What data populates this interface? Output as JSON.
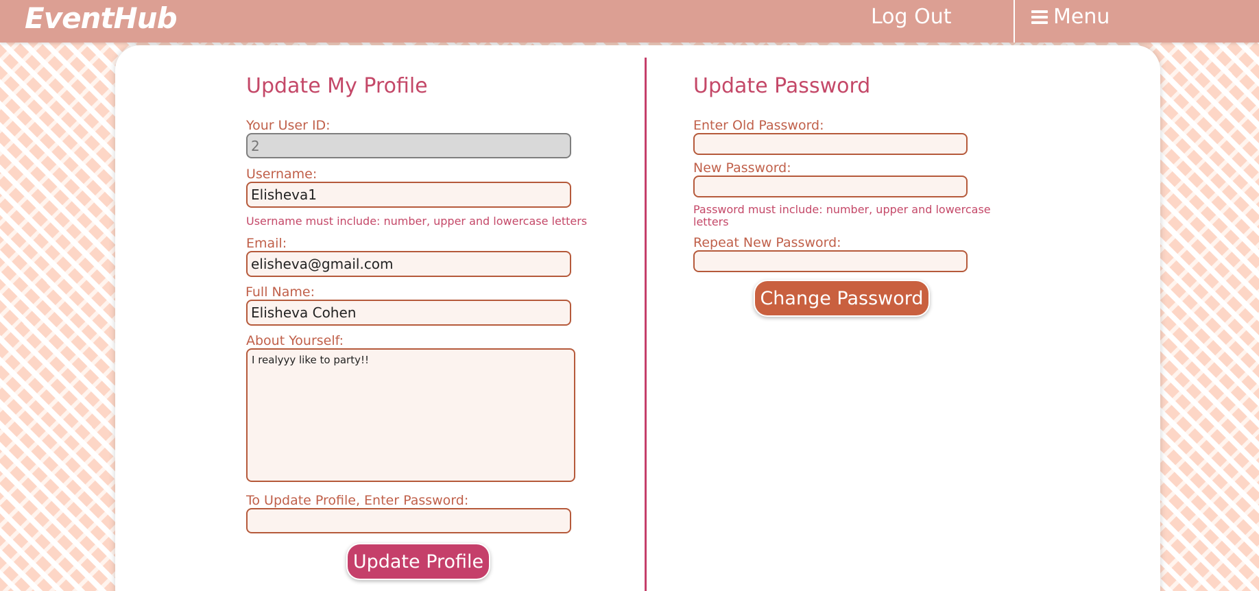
{
  "header": {
    "logo": "EventHub",
    "logout_label": "Log Out",
    "menu_label": "Menu"
  },
  "profile": {
    "title": "Update My Profile",
    "user_id_label": "Your User ID:",
    "user_id_value": "2",
    "username_label": "Username:",
    "username_value": "Elisheva1",
    "username_hint": "Username must include: number, upper and lowercase letters",
    "email_label": "Email:",
    "email_value": "elisheva@gmail.com",
    "fullname_label": "Full Name:",
    "fullname_value": "Elisheva Cohen",
    "about_label": "About Yourself:",
    "about_value": "I realyyy like to party!!",
    "password_label": "To Update Profile, Enter Password:",
    "password_value": "",
    "submit_label": "Update Profile"
  },
  "password": {
    "title": "Update Password",
    "old_label": "Enter Old Password:",
    "new_label": "New Password:",
    "hint": "Password must include: number, upper and lowercase letters",
    "repeat_label": "Repeat New Password:",
    "submit_label": "Change Password"
  },
  "colors": {
    "header": "#dc9f93",
    "title": "#c44868",
    "label": "#c0604a",
    "input_border": "#b5593a",
    "update_button": "#c53f6a",
    "change_button": "#c9603f"
  }
}
